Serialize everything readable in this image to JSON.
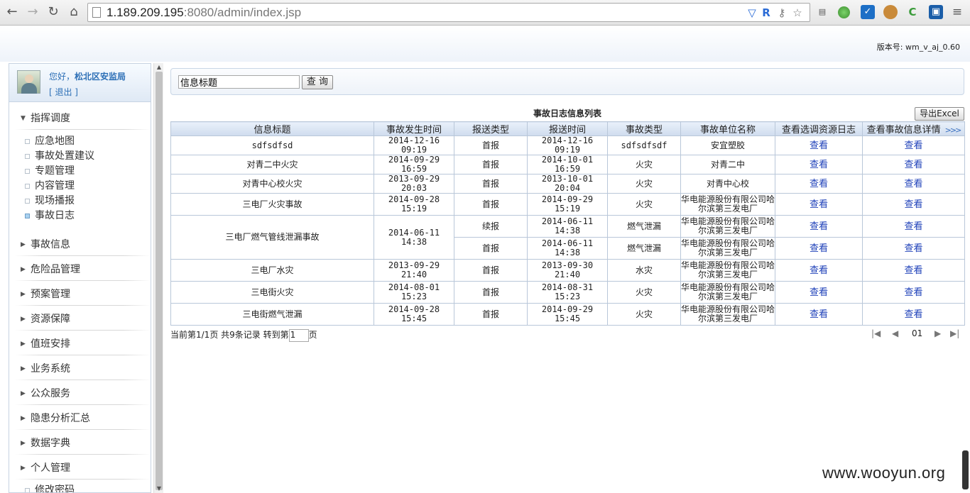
{
  "browser": {
    "url_host": "1.189.209.195",
    "url_rest": ":8080/admin/index.jsp"
  },
  "header": {
    "version_label": "版本号:",
    "version_value": "wm_v_aj_0.60"
  },
  "user": {
    "greeting": "您好，",
    "name": "松北区安监局",
    "logout": "[  退出  ]"
  },
  "sidebar": {
    "groups": [
      {
        "label": "指挥调度",
        "expanded": true,
        "items": [
          "应急地图",
          "事故处置建议",
          "专题管理",
          "内容管理",
          "现场播报",
          "事故日志"
        ]
      },
      {
        "label": "事故信息"
      },
      {
        "label": "危险品管理"
      },
      {
        "label": "预案管理"
      },
      {
        "label": "资源保障"
      },
      {
        "label": "值班安排"
      },
      {
        "label": "业务系统"
      },
      {
        "label": "公众服务"
      },
      {
        "label": "隐患分析汇总"
      },
      {
        "label": "数据字典"
      },
      {
        "label": "个人管理"
      }
    ],
    "last_item": "修改密码",
    "active_item": "事故日志"
  },
  "search": {
    "value": "信息标题",
    "button": "查 询"
  },
  "table": {
    "title": "事故日志信息列表",
    "export": "导出Excel",
    "headers": [
      "信息标题",
      "事故发生时间",
      "报送类型",
      "报送时间",
      "事故类型",
      "事故单位名称",
      "查看选调资源日志",
      "查看事故信息详情"
    ],
    "more_glyph": ">>>",
    "link_text": "查看",
    "rows": [
      {
        "title": "sdfsdfsd",
        "occur": "2014-12-16 09:19",
        "type": "首报",
        "report": "2014-12-16 09:19",
        "kind": "sdfsdfsdf",
        "unit": "安宜塑胶"
      },
      {
        "title": "对青二中火灾",
        "occur": "2014-09-29 16:59",
        "type": "首报",
        "report": "2014-10-01 16:59",
        "kind": "火灾",
        "unit": "对青二中"
      },
      {
        "title": "对青中心校火灾",
        "occur": "2013-09-29 20:03",
        "type": "首报",
        "report": "2013-10-01 20:04",
        "kind": "火灾",
        "unit": "对青中心校"
      },
      {
        "title": "三电厂火灾事故",
        "occur": "2014-09-28 15:19",
        "type": "首报",
        "report": "2014-09-29 15:19",
        "kind": "火灾",
        "unit": "华电能源股份有限公司哈尔滨第三发电厂"
      },
      {
        "title": "三电厂燃气管线泄漏事故",
        "occur": "2014-06-11 14:38",
        "type": "续报",
        "report": "2014-06-11 14:38",
        "kind": "燃气泄漏",
        "unit": "华电能源股份有限公司哈尔滨第三发电厂"
      },
      {
        "type": "首报",
        "report": "2014-06-11 14:38",
        "kind": "燃气泄漏",
        "unit": "华电能源股份有限公司哈尔滨第三发电厂"
      },
      {
        "title": "三电厂水灾",
        "occur": "2013-09-29 21:40",
        "type": "首报",
        "report": "2013-09-30 21:40",
        "kind": "水灾",
        "unit": "华电能源股份有限公司哈尔滨第三发电厂"
      },
      {
        "title": "三电街火灾",
        "occur": "2014-08-01 15:23",
        "type": "首报",
        "report": "2014-08-31 15:23",
        "kind": "火灾",
        "unit": "华电能源股份有限公司哈尔滨第三发电厂"
      },
      {
        "title": "三电街燃气泄漏",
        "occur": "2014-09-28 15:45",
        "type": "首报",
        "report": "2014-09-29 15:45",
        "kind": "火灾",
        "unit": "华电能源股份有限公司哈尔滨第三发电厂"
      }
    ]
  },
  "pager": {
    "summary_prefix": "当前第1/1页 共9条记录 转到第",
    "goto_value": "1",
    "summary_suffix": "页",
    "page_number": "01"
  },
  "watermark": "www.wooyun.org"
}
